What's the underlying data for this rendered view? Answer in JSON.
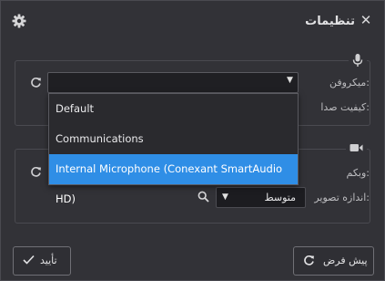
{
  "dialog": {
    "title": "تنظیمات"
  },
  "audio": {
    "microphone_label": "میکروفن:",
    "quality_label": "کیفیت صدا:",
    "microphone_value": "",
    "dropdown_options": [
      "Default",
      "Communications",
      "Internal Microphone (Conexant SmartAudio HD)"
    ],
    "selected_index": 2
  },
  "video": {
    "webcam_label": "وبکم:",
    "image_size_label": "اندازه تصویر:",
    "image_size_value": "متوسط"
  },
  "buttons": {
    "confirm_label": "تأیید",
    "reset_label": "پیش فرض"
  },
  "colors": {
    "background": "#323237",
    "selected_option": "#2f8ee6",
    "border": "#4a4a50"
  },
  "icons": [
    "close-icon",
    "gear-icon",
    "microphone-icon",
    "camera-icon",
    "refresh-icon",
    "search-icon",
    "checkmark-icon",
    "dropdown-arrow-icon"
  ]
}
